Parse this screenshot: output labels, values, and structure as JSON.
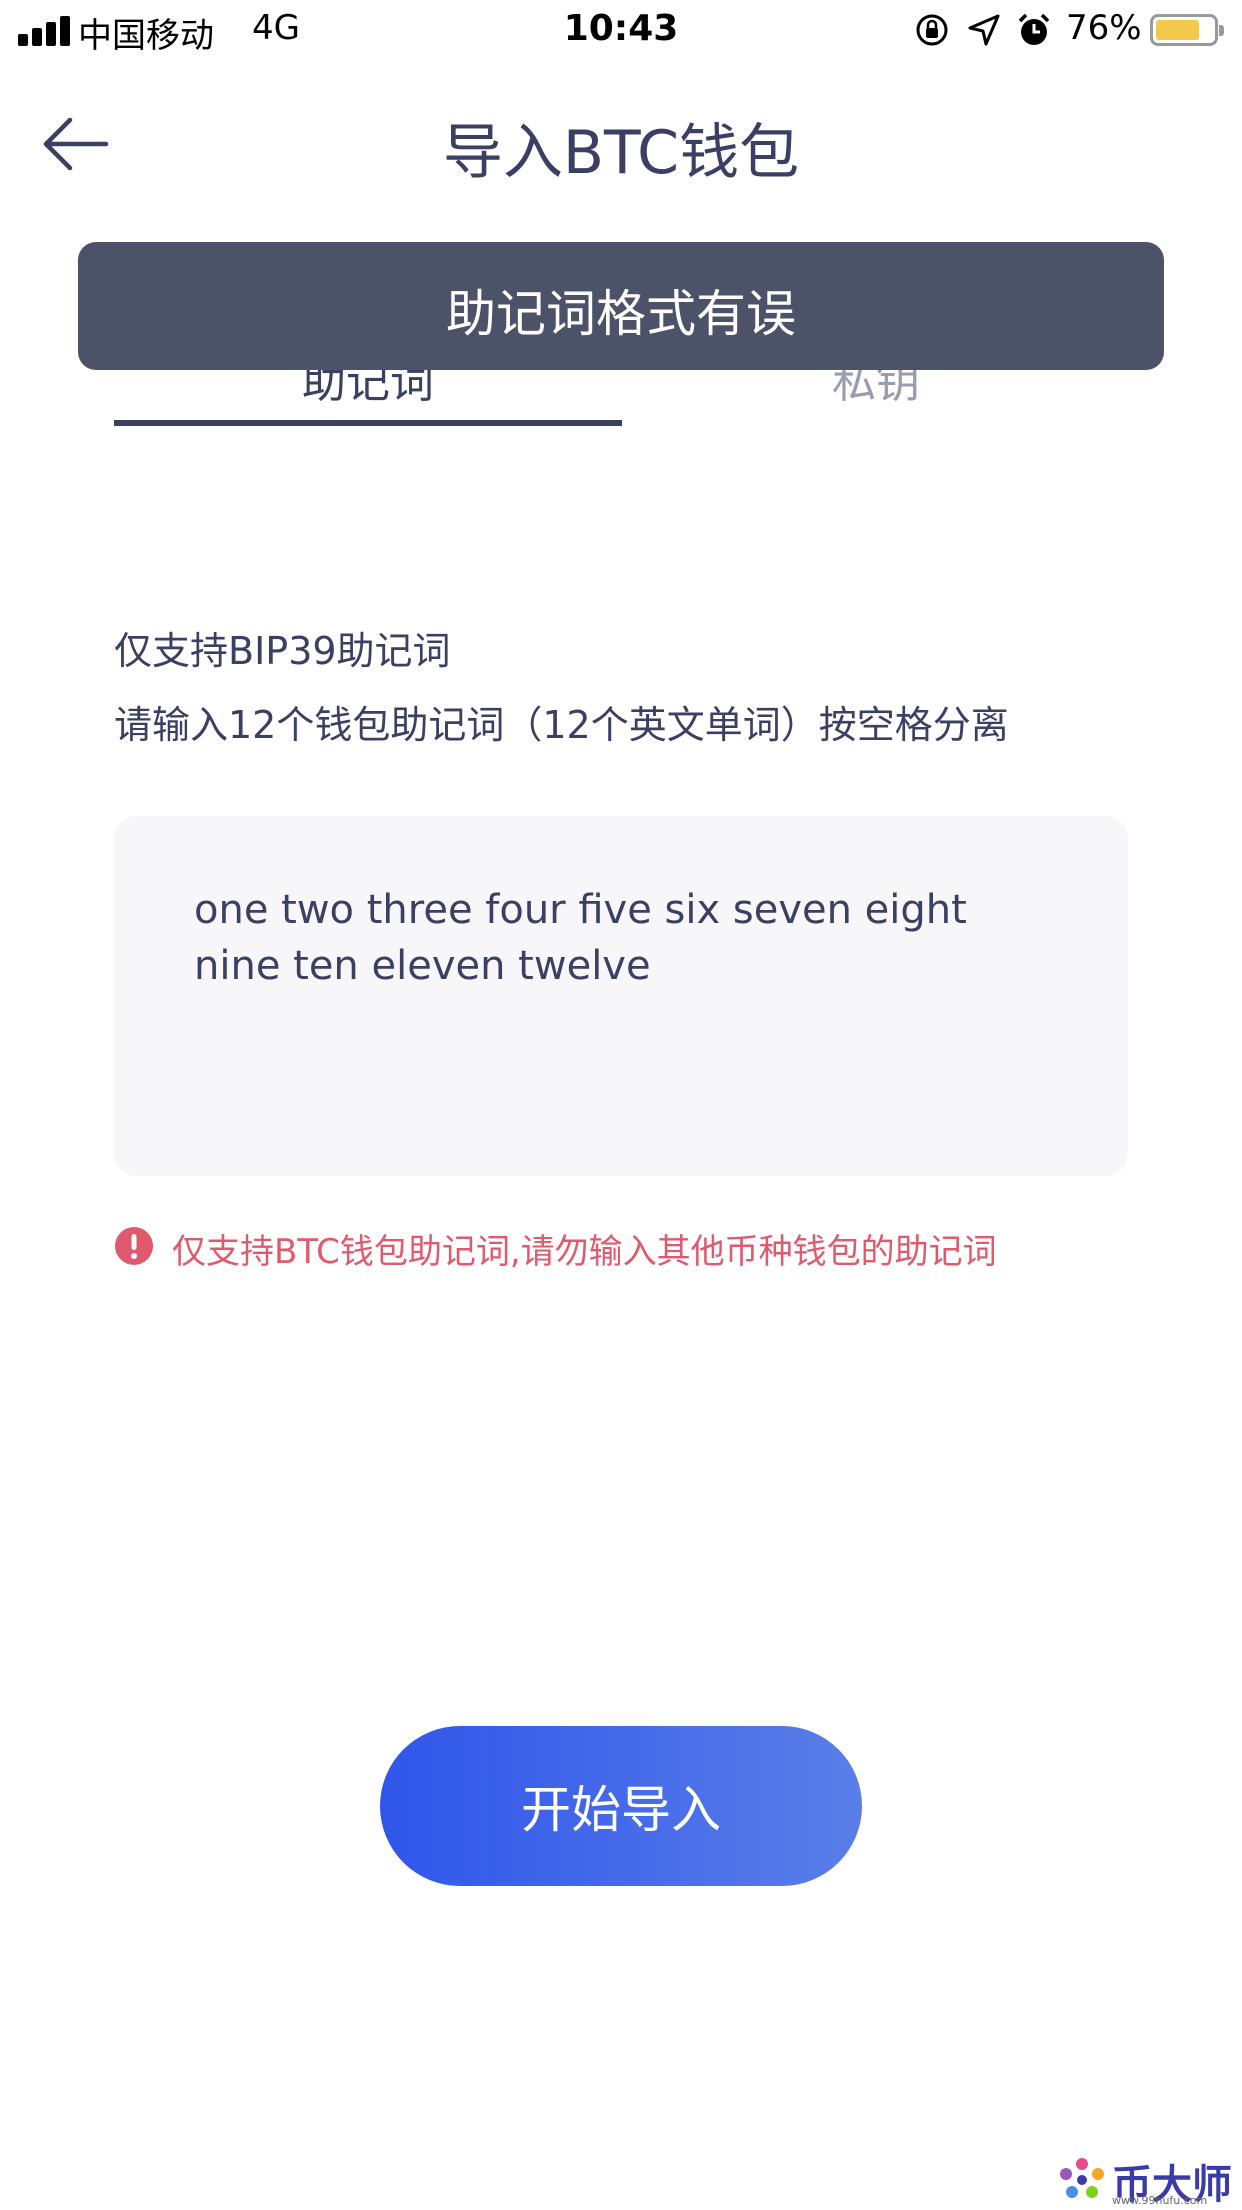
{
  "status_bar": {
    "carrier": "中国移动",
    "network": "4G",
    "time": "10:43",
    "battery_percent": "76%",
    "battery_level": 0.76,
    "icons": [
      "signal-icon",
      "orientation-lock-icon",
      "location-icon",
      "alarm-icon",
      "battery-icon"
    ]
  },
  "nav": {
    "back_icon": "arrow-left-icon",
    "title": "导入BTC钱包"
  },
  "toast": {
    "message": "助记词格式有误"
  },
  "tabs": [
    {
      "label": "助记词",
      "active": true
    },
    {
      "label": "私钥",
      "active": false
    }
  ],
  "instructions": {
    "line1": "仅支持BIP39助记词",
    "line2": "请输入12个钱包助记词（12个英文单词）按空格分离"
  },
  "mnemonic_input": {
    "value": "one two three four five six seven eight nine ten eleven twelve"
  },
  "warning": {
    "icon": "exclamation-circle-icon",
    "text": "仅支持BTC钱包助记词,请勿输入其他币种钱包的助记词"
  },
  "import_button": {
    "label": "开始导入"
  },
  "watermark": {
    "brand": "币大师",
    "url": "www.99hufu.com"
  },
  "colors": {
    "text_primary": "#3b3f63",
    "tab_inactive": "#9a9cb0",
    "toast_bg": "#4c5268",
    "warning": "#e05a6e",
    "button_gradient_start": "#2f56ea",
    "button_gradient_end": "#5a7ee8",
    "input_bg": "#f7f7f9"
  }
}
